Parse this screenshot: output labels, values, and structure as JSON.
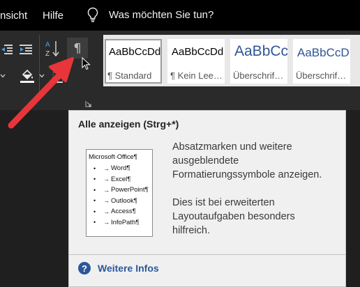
{
  "menubar": {
    "items": [
      "nsicht",
      "Hilfe"
    ],
    "tell_me": "Was möchten Sie tun?"
  },
  "ribbon": {
    "pilcrow_symbol": "¶",
    "styles": [
      {
        "sample": "AaBbCcDd",
        "name": "¶ Standard",
        "selected": true
      },
      {
        "sample": "AaBbCcDd",
        "name": "¶ Kein Lee…",
        "selected": false
      },
      {
        "sample": "AaBbCc",
        "name": "Überschrif…",
        "selected": false
      },
      {
        "sample": "AaBbCcD",
        "name": "Überschrif…",
        "selected": false
      }
    ]
  },
  "tooltip": {
    "title": "Alle anzeigen (Strg+*)",
    "preview": {
      "heading": "Microsoft·Office¶",
      "items": [
        "Word¶",
        "Excel¶",
        "PowerPoint¶",
        "Outlook¶",
        "Access¶",
        "InfoPath¶"
      ]
    },
    "description": [
      "Absatzmarken und weitere ausgeblendete Formatierungssymbole anzeigen.",
      "Dies ist bei erweiterten Layoutaufgaben besonders hilfreich."
    ],
    "more_info": "Weitere Infos",
    "help_symbol": "?"
  },
  "colors": {
    "menubar_bg": "#000000",
    "ribbon_bg": "#2a2a2a",
    "tooltip_bg": "#f0f0f0",
    "link": "#2b579a",
    "heading_style": "#2f5597",
    "annotation_arrow": "#e8353a"
  }
}
